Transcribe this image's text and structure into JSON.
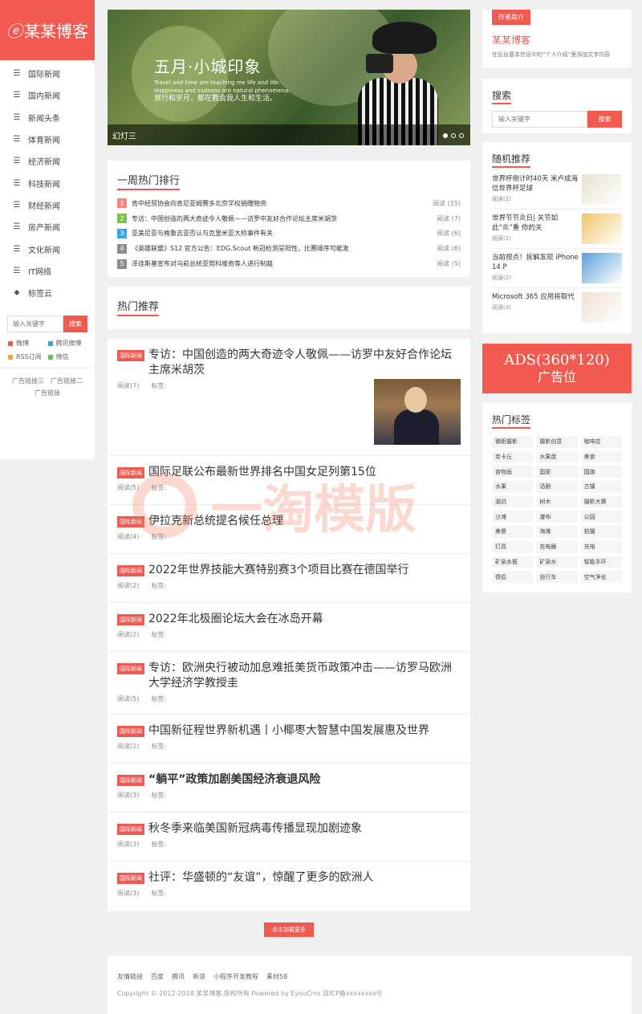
{
  "sidebar": {
    "logo": "某某博客",
    "nav": [
      {
        "label": "国际新闻",
        "icon": "list-icon"
      },
      {
        "label": "国内新闻",
        "icon": "list-icon"
      },
      {
        "label": "新闻头条",
        "icon": "list-icon"
      },
      {
        "label": "体育新闻",
        "icon": "list-icon"
      },
      {
        "label": "经济新闻",
        "icon": "list-icon"
      },
      {
        "label": "科技新闻",
        "icon": "list-icon"
      },
      {
        "label": "财经新闻",
        "icon": "list-icon"
      },
      {
        "label": "房产新闻",
        "icon": "list-icon"
      },
      {
        "label": "文化新闻",
        "icon": "list-icon"
      },
      {
        "label": "IT网络",
        "icon": "list-icon"
      },
      {
        "label": "标签云",
        "icon": "tag-icon"
      }
    ],
    "search_placeholder": "输入关键字",
    "search_button": "搜索",
    "social": [
      {
        "label": "微博",
        "color": "#f05a50"
      },
      {
        "label": "腾讯微博",
        "color": "#3aa0e6"
      },
      {
        "label": "RSS订阅",
        "color": "#f3a63a"
      },
      {
        "label": "微信",
        "color": "#5cc05c"
      }
    ],
    "ad_links": [
      "广告链接三",
      "广告链接二",
      "广告链接"
    ]
  },
  "banner": {
    "title": "五月·小城印象",
    "sub_en1": "Travel and time are teaching me life and life.",
    "sub_en2": "Happiness and sadness are natural phenomena.",
    "sub_cn": "旅行和岁月，都在教会我人生和生活。",
    "caption": "幻灯三"
  },
  "rank": {
    "title": "一周热门排行",
    "items": [
      {
        "num": "1",
        "color": "#f5877e",
        "text": "肯中经贸协会向肯尼亚姆赛多北京学校捐赠物资",
        "views": "阅读 (15)"
      },
      {
        "num": "2",
        "color": "#7cc24a",
        "text": "专访：中国创造的两大奇迹令人敬佩——访罗中友好合作论坛主席米胡茨",
        "views": "阅读 (7)"
      },
      {
        "num": "3",
        "color": "#3aa8e0",
        "text": "亚美尼亚与格鲁吉亚否认与克里米亚大桥事件有关",
        "views": "阅读 (6)"
      },
      {
        "num": "4",
        "color": "#8c8c8c",
        "text": "《英雄联盟》S12 官方公告：EDG.Scout 新冠检测呈阳性，比赛顺序可能发",
        "views": "阅读 (6)"
      },
      {
        "num": "5",
        "color": "#8c8c8c",
        "text": "泽连斯基宣布对乌前总统亚努科维奇等人进行制裁",
        "views": "阅读 (5)"
      }
    ]
  },
  "hot": {
    "title": "热门推荐"
  },
  "articles": [
    {
      "tag": "国际新闻",
      "title": "专访：中国创造的两大奇迹令人敬佩——访罗中友好合作论坛主席米胡茨",
      "read": "阅读(7)",
      "tags": "标签:",
      "bold": false,
      "thumb": true
    },
    {
      "tag": "国际新闻",
      "title": "国际足联公布最新世界排名中国女足列第15位",
      "read": "阅读(5)",
      "tags": "标签:",
      "bold": false
    },
    {
      "tag": "国际新闻",
      "title": "伊拉克新总统提名候任总理",
      "read": "阅读(4)",
      "tags": "标签:",
      "bold": false
    },
    {
      "tag": "国际新闻",
      "title": "2022年世界技能大赛特别赛3个项目比赛在德国举行",
      "read": "阅读(2)",
      "tags": "标签:",
      "bold": false
    },
    {
      "tag": "国际新闻",
      "title": "2022年北极圈论坛大会在冰岛开幕",
      "read": "阅读(2)",
      "tags": "标签:",
      "bold": false
    },
    {
      "tag": "国际新闻",
      "title": "专访：欧洲央行被动加息难抵美货币政策冲击——访罗马欧洲大学经济学教授圭",
      "read": "阅读(5)",
      "tags": "标签:",
      "bold": false
    },
    {
      "tag": "国际新闻",
      "title": "中国新征程世界新机遇丨小椰枣大智慧中国发展惠及世界",
      "read": "阅读(2)",
      "tags": "标签:",
      "bold": false
    },
    {
      "tag": "国际新闻",
      "title": "“躺平”政策加剧美国经济衰退风险",
      "read": "阅读(3)",
      "tags": "标签:",
      "bold": true
    },
    {
      "tag": "国际新闻",
      "title": "秋冬季来临美国新冠病毒传播显现加剧迹象",
      "read": "阅读(3)",
      "tags": "标签:",
      "bold": false
    },
    {
      "tag": "国际新闻",
      "title": "社评：华盛顿的“友谊”，惊醒了更多的欧洲人",
      "read": "阅读(3)",
      "tags": "标签:",
      "bold": false
    }
  ],
  "load_more": "点击加载更多",
  "footer": {
    "links": [
      "友情链接",
      "百度",
      "腾讯",
      "新浪",
      "小程序开发教程",
      "素材58"
    ],
    "copyright": "Copyright © 2012-2018 某某博客 版权所有 Powered by EyouCms 琼ICP备xxxxxxxx号"
  },
  "author": {
    "badge": "作者简介",
    "name": "某某博客",
    "desc": "在后台基本信息中的“个人介绍”里添加文字内容"
  },
  "right_search": {
    "title": "搜索",
    "placeholder": "输入关键字",
    "button": "搜索"
  },
  "random": {
    "title": "随机推荐",
    "items": [
      {
        "title": "世界杯倒计时40天 米卢成海信世界杯足球",
        "meta": "阅读(2)",
        "img": "#e8e2d0"
      },
      {
        "title": "世界节节炎日| 关节如此“炎”重 你的关",
        "meta": "阅读(2)",
        "img": "#f2c46a"
      },
      {
        "title": "当前视点！拆解发现 iPhone 14 P",
        "meta": "阅读(2)",
        "img": "#5aa0d8"
      },
      {
        "title": "Microsoft 365 应用将取代",
        "meta": "阅读(3)",
        "img": "#f0e0d8"
      }
    ]
  },
  "ads": {
    "line1": "ADS(360*120)",
    "line2": "广告位"
  },
  "hot_tags": {
    "title": "热门标签",
    "items": [
      "微距摄影",
      "摄影创意",
      "咖啡店",
      "炭卡丘",
      "水果盘",
      "美食",
      "食物画",
      "国家",
      "国旗",
      "水果",
      "话剧",
      "古镇",
      "湖泊",
      "树木",
      "摄影大赛",
      "沙滩",
      "瀑布",
      "公园",
      "美景",
      "海滩",
      "拍摄",
      "灯具",
      "充电器",
      "充电",
      "矿泉水瓶",
      "矿泉水",
      "智能手环",
      "情侣",
      "自行车",
      "空气净化"
    ]
  },
  "watermark": "一淘模版"
}
